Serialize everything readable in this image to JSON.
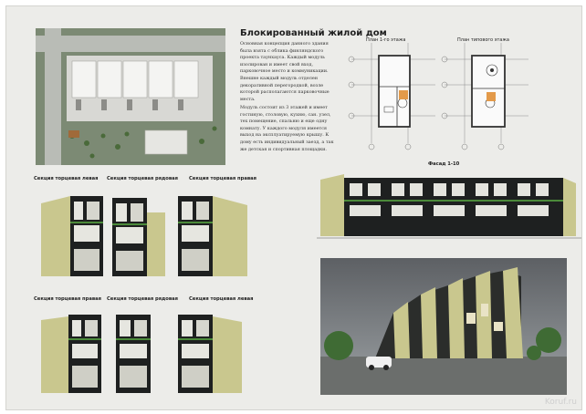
{
  "title": "Блокированный жилой дом",
  "paragraphs": [
    "Основная концепция данного здания была взята с облика финляндского проекта таунхауса. Каждый модуль изолирован и имеет свой вход, парковочное место и коммуникации. Внешне каждый модуль отделен декоративной перегородкой, возле которой располагаются парковочные места.",
    "Модуль состоит из 3 этажей и имеет гостиную, столовую, кухню, сан. узел, тех помещение, спальню и еще одну комнату. У каждого модуля имеется выход на эксплуатируемую крышу. К дому есть индивидуальный заезд, а так же детская и спортивная площадки."
  ],
  "plans": {
    "first_floor": "План 1-го этажа",
    "typical_floor": "План типового этажа"
  },
  "facade_label": "Фасад 1-10",
  "sections_top": [
    "Секция торцевая левая",
    "Секция торцевая рядовая",
    "Секция торцевая правая"
  ],
  "sections_bottom": [
    "Секция торцевая правая",
    "Секция торцевая рядовая",
    "Секция торцевая левая"
  ],
  "watermark": "Koruf.ru",
  "colors": {
    "sheet": "#ecece9",
    "facade_dark": "#1e2020",
    "facade_accent": "#c9c78e",
    "site_green": "#7e8a76"
  }
}
